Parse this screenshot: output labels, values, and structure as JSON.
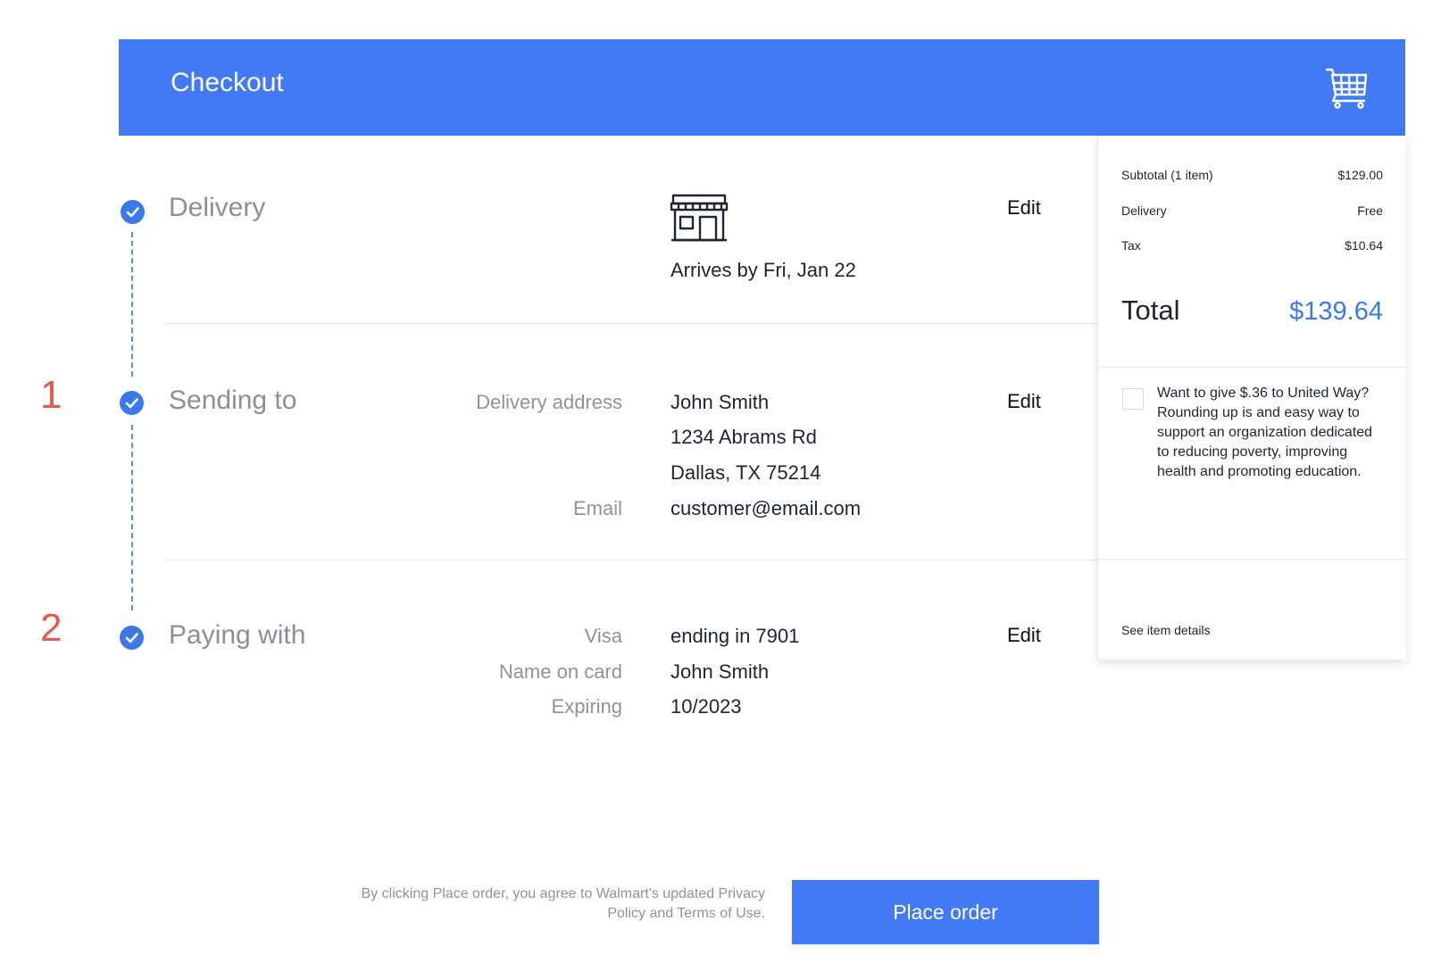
{
  "header": {
    "title": "Checkout",
    "icon": "cart-icon"
  },
  "markers": [
    "1",
    "2"
  ],
  "sections": {
    "delivery": {
      "title": "Delivery",
      "icon": "store-icon",
      "arrives": "Arrives by Fri, Jan 22",
      "edit": "Edit"
    },
    "sending_to": {
      "title": "Sending to",
      "address_label": "Delivery address",
      "name": "John Smith",
      "street": "1234 Abrams Rd",
      "city": "Dallas, TX 75214",
      "email_label": "Email",
      "email": "customer@email.com",
      "edit": "Edit"
    },
    "paying_with": {
      "title": "Paying with",
      "card_label": "Visa",
      "card_value": "ending in 7901",
      "name_label": "Name on card",
      "name_value": "John Smith",
      "exp_label": "Expiring",
      "exp_value": "10/2023",
      "edit": "Edit"
    }
  },
  "summary": {
    "subtotal_label": "Subtotal (1 item)",
    "subtotal_value": "$129.00",
    "delivery_label": "Delivery",
    "delivery_value": "Free",
    "tax_label": "Tax",
    "tax_value": "$10.64",
    "total_label": "Total",
    "total_value": "$139.64",
    "donation_text": "Want to give  $.36 to United Way? Rounding up is and easy way to support an organization dedicated to reducing poverty, improving health and promoting education.",
    "see_details": "See item details"
  },
  "footer": {
    "legal": "By clicking Place order, you agree to Walmart's updated Privacy Policy and Terms of Use.",
    "place_order": "Place order"
  },
  "colors": {
    "primary": "#4279f4",
    "check": "#3c78ea",
    "marker": "#e35a4f"
  }
}
